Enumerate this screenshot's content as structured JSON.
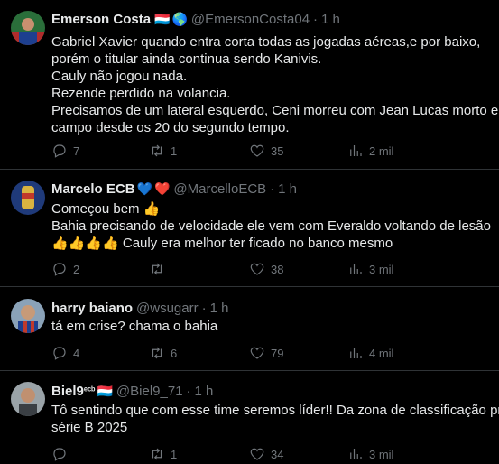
{
  "posts": [
    {
      "name": "Emerson Costa",
      "badges": [
        "🇱🇺",
        "🌎"
      ],
      "handle": "@EmersonCosta04",
      "time": "1 h",
      "lines": [
        "Gabriel Xavier quando entra corta todas as jogadas aéreas,e por baixo,",
        "porém o titular ainda continua sendo Kanivis.",
        "Cauly não jogou nada.",
        "Rezende perdido na volancia.",
        "Precisamos de um lateral esquerdo, Ceni morreu com Jean Lucas morto em",
        "campo desde os 20 do segundo tempo."
      ],
      "replies": "7",
      "reposts": "1",
      "likes": "35",
      "views": "2 mil"
    },
    {
      "name": "Marcelo ECB",
      "badges": [
        "💙",
        "❤️"
      ],
      "handle": "@MarcelloECB",
      "time": "1 h",
      "lines": [
        "Começou bem 👍",
        "Bahia precisando de velocidade ele vem com Everaldo voltando de lesão",
        "👍👍👍👍 Cauly era melhor ter ficado no banco mesmo"
      ],
      "replies": "2",
      "reposts": "",
      "likes": "38",
      "views": "3 mil"
    },
    {
      "name": "harry baiano",
      "badges": [],
      "handle": "@wsugarr",
      "time": "1 h",
      "lines": [
        "tá em crise? chama o bahia"
      ],
      "replies": "4",
      "reposts": "6",
      "likes": "79",
      "views": "4 mil"
    },
    {
      "name": "Biel9",
      "badges": [
        "ᵉᶜᵇ",
        "🇱🇺"
      ],
      "handle": "@Biel9_71",
      "time": "1 h",
      "lines": [
        "Tô sentindo que com esse time seremos líder!! Da zona de classificação pra",
        "série B 2025"
      ],
      "replies": "",
      "reposts": "1",
      "likes": "34",
      "views": "3 mil"
    }
  ],
  "colors": {
    "background": "#000000",
    "text": "#e7e9ea",
    "muted": "#71767b",
    "divider": "#2f3336"
  },
  "icons": [
    "reply-icon",
    "repost-icon",
    "like-icon",
    "views-icon"
  ]
}
